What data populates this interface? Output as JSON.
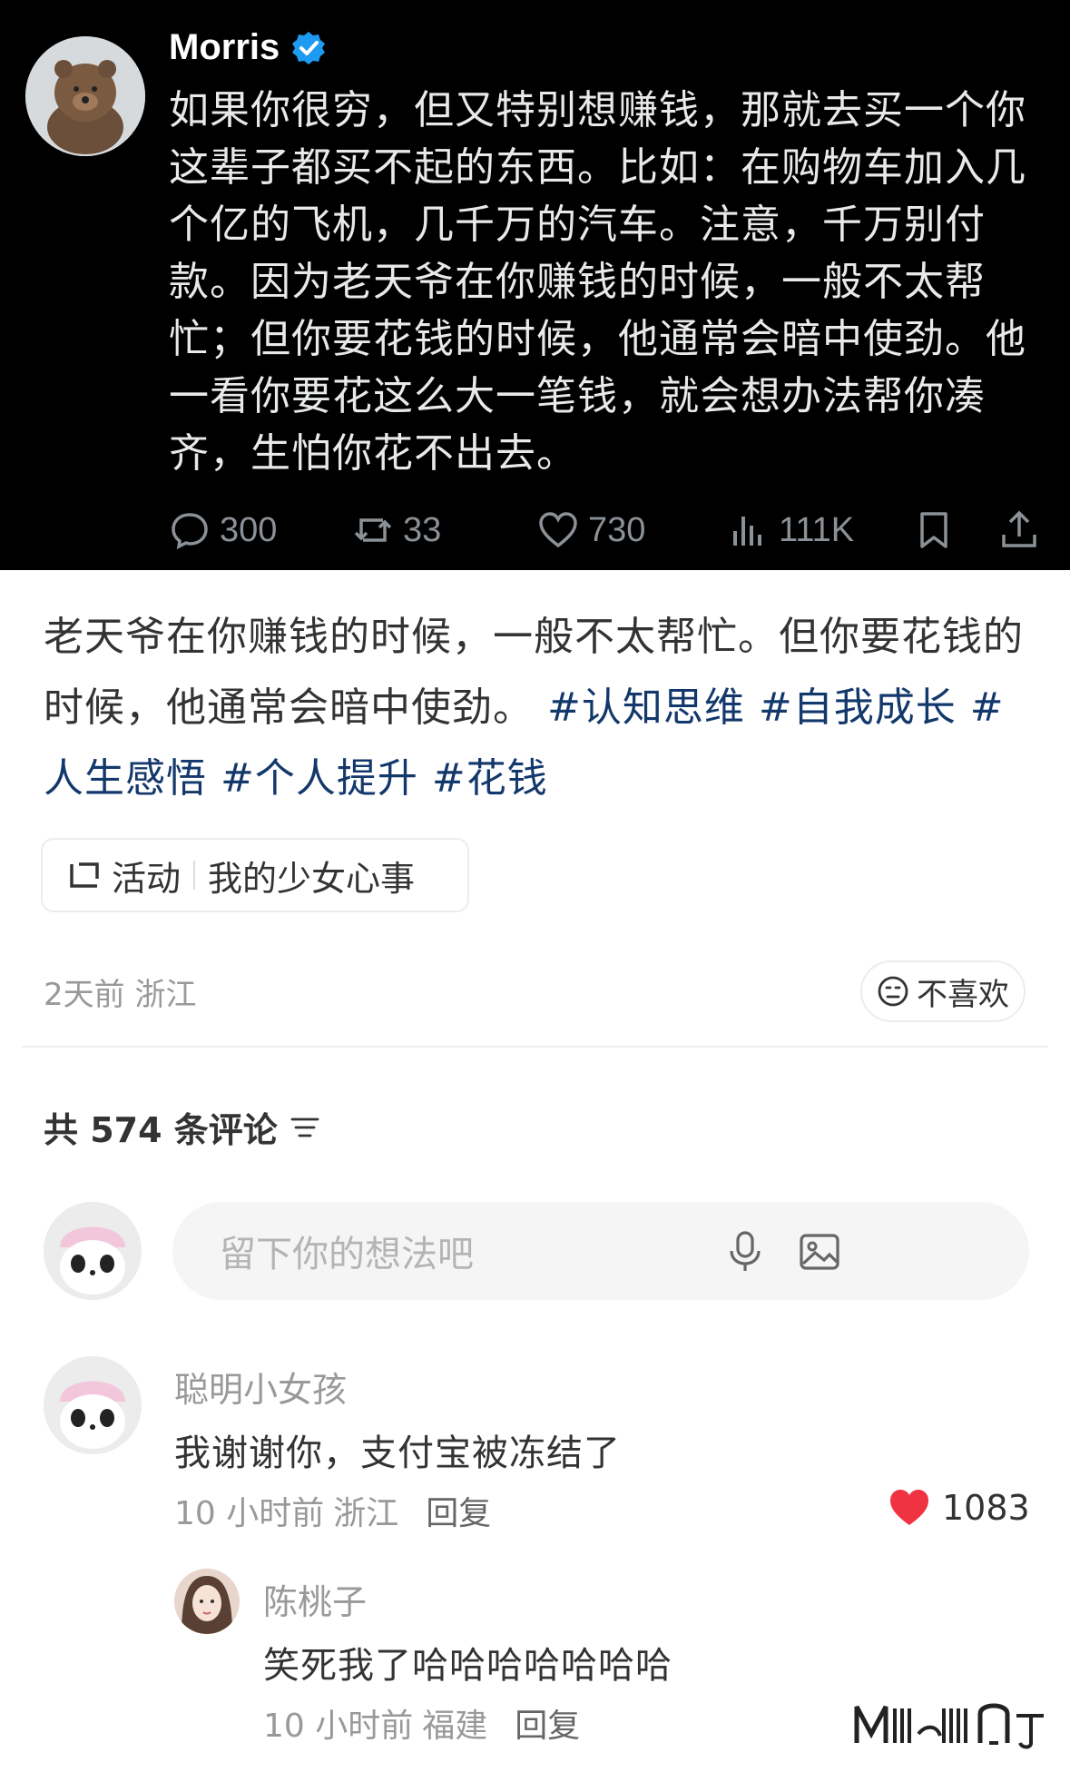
{
  "tweet": {
    "author": "Morris",
    "text": "如果你很穷，但又特别想赚钱，那就去买一个你这辈子都买不起的东西。比如：在购物车加入几个亿的飞机，几千万的汽车。注意，千万别付款。因为老天爷在你赚钱的时候，一般不太帮忙；但你要花钱的时候，他通常会暗中使劲。他一看你要花这么大一笔钱，就会想办法帮你凑齐，生怕你花不出去。",
    "stats": {
      "replies": "300",
      "retweets": "33",
      "likes": "730",
      "views": "111K"
    }
  },
  "post": {
    "text_before_tags": "老天爷在你赚钱的时候，一般不太帮忙。但你要花钱的时候，他通常会暗中使劲。",
    "hashtags": [
      "#认知思维",
      "#自我成长",
      "#人生感悟",
      "#个人提升",
      "#花钱"
    ],
    "activity_label": "活动",
    "activity_name": "我的少女心事",
    "meta": "2天前 浙江",
    "dislike_label": "不喜欢"
  },
  "comments_section": {
    "count_label": "共 574 条评论",
    "input_placeholder": "留下你的想法吧"
  },
  "comments": [
    {
      "user": "聪明小女孩",
      "text": "我谢谢你，支付宝被冻结了",
      "time": "10 小时前",
      "location": "浙江",
      "reply_label": "回复",
      "likes": "1083"
    }
  ],
  "replies": [
    {
      "user": "陈桃子",
      "text": "笑死我了哈哈哈哈哈哈哈",
      "time": "10 小时前",
      "location": "福建",
      "reply_label": "回复"
    }
  ],
  "colors": {
    "hashtag": "#13386c",
    "verified": "#1d9bf0",
    "like_heart": "#ef3340"
  }
}
